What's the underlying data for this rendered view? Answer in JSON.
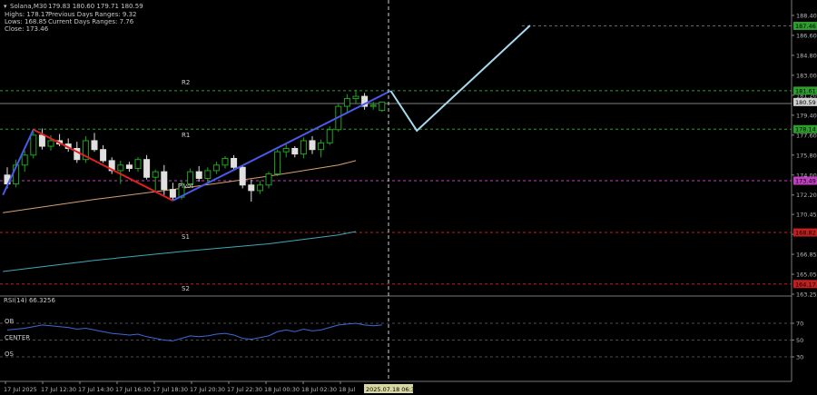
{
  "header": {
    "symbol": "Solana,M30",
    "ohlc": "179.83 180.60 179.71 180.59",
    "highs_label": "Highs: 178.17",
    "lows_label": "Lows: 168.85",
    "close_label": "Close: 173.46",
    "prev_range_label": "Previous Days Ranges: 9.32",
    "curr_range_label": "Current Days Ranges: 7.76"
  },
  "pivot_labels": {
    "r2": "R2",
    "r1": "R1",
    "pivot": "Pivot",
    "s1": "S1",
    "s2": "S2"
  },
  "rsi": {
    "title": "RSI(14) 66.3256",
    "ob": "OB",
    "center": "CENTER",
    "os": "OS"
  },
  "price_axis": [
    "188.40",
    "186.60",
    "184.80",
    "183.00",
    "181.20",
    "179.40",
    "177.60",
    "175.80",
    "174.00",
    "172.20",
    "170.45",
    "168.65",
    "166.85",
    "165.05",
    "163.25"
  ],
  "rsi_axis": [
    "70",
    "50",
    "30"
  ],
  "tags": {
    "target": "187.46",
    "r2": "181.61",
    "current": "180.59",
    "r1": "178.14",
    "pivot": "173.49",
    "s1": "168.82",
    "s2": "164.17"
  },
  "tag_colors": {
    "target": "#2e9d2e",
    "r2": "#2e9d2e",
    "current": "#d0d0d0",
    "r1": "#2e9d2e",
    "pivot": "#c040c0",
    "s1": "#c02020",
    "s2": "#c02020"
  },
  "time_axis": [
    "17 Jul 2025",
    "17 Jul 12:30",
    "17 Jul 14:30",
    "17 Jul 16:30",
    "17 Jul 18:30",
    "17 Jul 20:30",
    "17 Jul 22:30",
    "18 Jul 00:30",
    "18 Jul 02:30",
    "18 Jul"
  ],
  "cursor_time": "2025.07.18 06:30",
  "colors": {
    "bull": "#1fa51f",
    "bear": "#e0e0e0",
    "wave_up": "#4a5ae8",
    "wave_down": "#e02020",
    "forecast": "#a8d8ec",
    "ma_slow": "#3ea9b8",
    "ma_fast": "#d8a070",
    "rsi_line": "#3e68d8"
  },
  "chart_data": {
    "type": "candlestick",
    "timeframe": "M30",
    "symbol": "Solana",
    "ylim": [
      163.25,
      188.9
    ],
    "rsi_ylim": [
      30,
      70
    ],
    "candles": [
      {
        "o": 174.0,
        "h": 174.7,
        "l": 172.8,
        "c": 173.2
      },
      {
        "o": 173.2,
        "h": 175.4,
        "l": 172.9,
        "c": 174.9
      },
      {
        "o": 174.9,
        "h": 176.2,
        "l": 174.3,
        "c": 175.8
      },
      {
        "o": 175.8,
        "h": 177.9,
        "l": 175.5,
        "c": 177.6
      },
      {
        "o": 177.6,
        "h": 178.2,
        "l": 176.3,
        "c": 176.6
      },
      {
        "o": 176.6,
        "h": 177.6,
        "l": 176.2,
        "c": 177.1
      },
      {
        "o": 177.1,
        "h": 177.7,
        "l": 176.6,
        "c": 176.8
      },
      {
        "o": 176.8,
        "h": 177.3,
        "l": 176.1,
        "c": 176.4
      },
      {
        "o": 176.4,
        "h": 177.0,
        "l": 175.1,
        "c": 175.4
      },
      {
        "o": 175.4,
        "h": 177.5,
        "l": 175.1,
        "c": 177.1
      },
      {
        "o": 177.1,
        "h": 177.8,
        "l": 176.1,
        "c": 176.3
      },
      {
        "o": 176.3,
        "h": 176.7,
        "l": 175.1,
        "c": 175.3
      },
      {
        "o": 175.3,
        "h": 175.6,
        "l": 174.1,
        "c": 174.4
      },
      {
        "o": 174.4,
        "h": 175.3,
        "l": 173.2,
        "c": 174.9
      },
      {
        "o": 174.9,
        "h": 175.2,
        "l": 174.3,
        "c": 174.6
      },
      {
        "o": 174.6,
        "h": 175.6,
        "l": 174.3,
        "c": 175.4
      },
      {
        "o": 175.4,
        "h": 175.8,
        "l": 173.6,
        "c": 173.8
      },
      {
        "o": 173.8,
        "h": 174.5,
        "l": 172.6,
        "c": 174.3
      },
      {
        "o": 174.3,
        "h": 174.9,
        "l": 172.2,
        "c": 172.7
      },
      {
        "o": 172.7,
        "h": 173.3,
        "l": 171.7,
        "c": 172.0
      },
      {
        "o": 172.0,
        "h": 173.5,
        "l": 171.8,
        "c": 173.2
      },
      {
        "o": 173.2,
        "h": 174.6,
        "l": 172.9,
        "c": 174.3
      },
      {
        "o": 174.3,
        "h": 174.8,
        "l": 173.4,
        "c": 173.7
      },
      {
        "o": 173.7,
        "h": 174.7,
        "l": 173.3,
        "c": 174.4
      },
      {
        "o": 174.4,
        "h": 175.2,
        "l": 174.1,
        "c": 174.9
      },
      {
        "o": 174.9,
        "h": 175.7,
        "l": 174.6,
        "c": 175.5
      },
      {
        "o": 175.5,
        "h": 175.8,
        "l": 174.4,
        "c": 174.7
      },
      {
        "o": 174.7,
        "h": 174.9,
        "l": 172.8,
        "c": 173.1
      },
      {
        "o": 173.1,
        "h": 173.6,
        "l": 171.6,
        "c": 172.6
      },
      {
        "o": 172.6,
        "h": 173.5,
        "l": 172.3,
        "c": 173.1
      },
      {
        "o": 173.1,
        "h": 174.3,
        "l": 172.8,
        "c": 174.1
      },
      {
        "o": 174.1,
        "h": 176.3,
        "l": 173.9,
        "c": 176.1
      },
      {
        "o": 176.1,
        "h": 176.8,
        "l": 175.6,
        "c": 176.4
      },
      {
        "o": 176.4,
        "h": 176.6,
        "l": 175.6,
        "c": 175.9
      },
      {
        "o": 175.9,
        "h": 177.4,
        "l": 175.5,
        "c": 177.1
      },
      {
        "o": 177.1,
        "h": 177.5,
        "l": 175.9,
        "c": 176.3
      },
      {
        "o": 176.3,
        "h": 177.2,
        "l": 175.6,
        "c": 176.9
      },
      {
        "o": 176.9,
        "h": 178.4,
        "l": 176.7,
        "c": 178.1
      },
      {
        "o": 178.1,
        "h": 180.4,
        "l": 177.9,
        "c": 180.2
      },
      {
        "o": 180.2,
        "h": 181.3,
        "l": 179.6,
        "c": 180.9
      },
      {
        "o": 180.9,
        "h": 181.7,
        "l": 180.4,
        "c": 181.1
      },
      {
        "o": 181.1,
        "h": 181.4,
        "l": 179.9,
        "c": 180.2
      },
      {
        "o": 180.2,
        "h": 180.6,
        "l": 179.9,
        "c": 180.3
      },
      {
        "o": 179.83,
        "h": 180.6,
        "l": 179.71,
        "c": 180.59
      }
    ],
    "pivots": {
      "r2": 181.61,
      "r1": 178.14,
      "pivot": 173.49,
      "s1": 168.82,
      "s2": 164.17
    },
    "wave_up": [
      [
        -0.5,
        172.2
      ],
      [
        3,
        178.1
      ]
    ],
    "wave_down": [
      [
        3,
        178.1
      ],
      [
        19,
        171.7
      ]
    ],
    "wave_up2": [
      [
        19,
        171.7
      ],
      [
        44,
        181.6
      ]
    ],
    "forecast_path": [
      [
        44,
        181.6
      ],
      [
        47,
        178.0
      ],
      [
        60,
        187.5
      ]
    ],
    "ma_fast": [
      [
        -0.5,
        170.6
      ],
      [
        10,
        171.8
      ],
      [
        20,
        172.8
      ],
      [
        30,
        173.9
      ],
      [
        38,
        174.9
      ],
      [
        40,
        175.3
      ]
    ],
    "ma_slow": [
      [
        -0.5,
        165.3
      ],
      [
        10,
        166.3
      ],
      [
        20,
        167.1
      ],
      [
        30,
        167.8
      ],
      [
        38,
        168.6
      ],
      [
        40,
        168.9
      ]
    ],
    "rsi_values": [
      62,
      63,
      64,
      66,
      68,
      67,
      66,
      65,
      63,
      64,
      62,
      60,
      58,
      57,
      56,
      57,
      54,
      52,
      50,
      49,
      52,
      55,
      54,
      55,
      57,
      58,
      56,
      52,
      51,
      53,
      55,
      60,
      62,
      60,
      63,
      61,
      62,
      65,
      68,
      69,
      70,
      68,
      67,
      68
    ]
  }
}
